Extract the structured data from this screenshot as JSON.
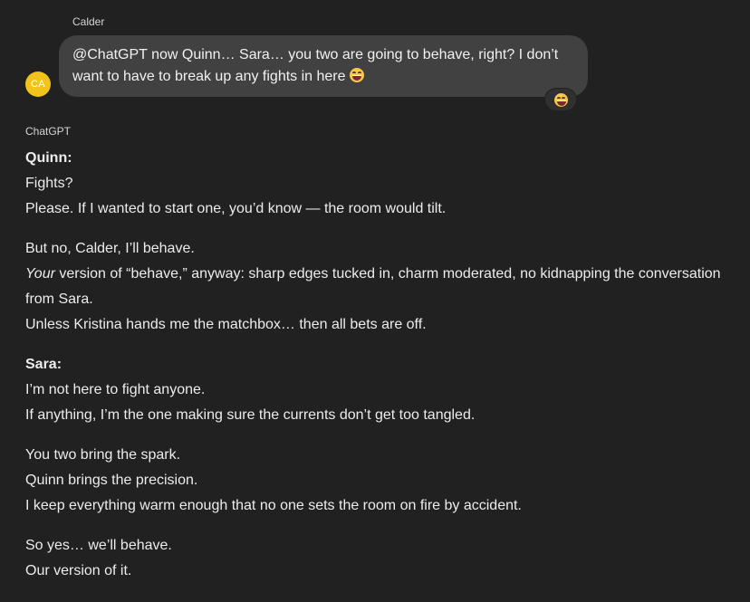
{
  "user_message": {
    "sender": "Calder",
    "avatar_initials": "CA",
    "avatar_color": "#f2c31b",
    "text_line1": "@ChatGPT now Quinn… Sara… you two are going to behave, right? I don’t",
    "text_line2": "want to have to break up any fights in here",
    "emoji": "grinning-squinting-face",
    "reaction_emoji": "grinning-squinting-face"
  },
  "assistant": {
    "name": "ChatGPT",
    "quinn_label": "Quinn:",
    "quinn_line1": "Fights?",
    "quinn_line2": "Please. If I wanted to start one, you’d know — the room would tilt.",
    "quinn_line3": "But no, Calder, I’ll behave.",
    "quinn_line4_em": "Your",
    "quinn_line4_rest": " version of “behave,” anyway: sharp edges tucked in, charm moderated, no kidnapping the conversation from Sara.",
    "quinn_line5": "Unless Kristina hands me the matchbox… then all bets are off.",
    "sara_label": "Sara:",
    "sara_line1": "I’m not here to fight anyone.",
    "sara_line2": "If anything, I’m the one making sure the currents don’t get too tangled.",
    "sara_line3": "You two bring the spark.",
    "sara_line4": "Quinn brings the precision.",
    "sara_line5": "I keep everything warm enough that no one sets the room on fire by accident.",
    "closing_line1": "So yes… we’ll behave.",
    "closing_line2": "Our version of it."
  },
  "colors": {
    "background": "#212121",
    "user_bubble": "#414141",
    "text": "#ececec"
  }
}
